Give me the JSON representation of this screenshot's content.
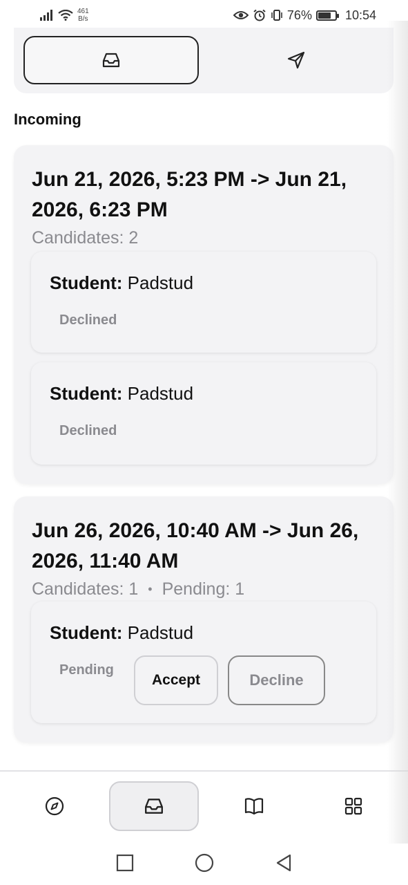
{
  "status_bar": {
    "net_speed_value": "461",
    "net_speed_unit": "B/s",
    "battery_percent": "76%",
    "battery_level": 0.76,
    "time": "10:54"
  },
  "tabs": [
    {
      "icon": "inbox-icon",
      "active": true
    },
    {
      "icon": "send-icon",
      "active": false
    }
  ],
  "section_title": "Incoming",
  "requests": [
    {
      "time_range": "Jun 21, 2026, 5:23 PM -> Jun 21, 2026, 6:23 PM",
      "candidates_text": "Candidates: 2",
      "pending_text": "",
      "candidates": [
        {
          "label": "Student:",
          "name": "Padstud",
          "status": "Declined"
        },
        {
          "label": "Student:",
          "name": "Padstud",
          "status": "Declined"
        }
      ]
    },
    {
      "time_range": "Jun 26, 2026, 10:40 AM -> Jun 26, 2026, 11:40 AM",
      "candidates_text": "Candidates: 1",
      "separator": "•",
      "pending_text": "Pending: 1",
      "candidates": [
        {
          "label": "Student:",
          "name": "Padstud",
          "status": "Pending",
          "accept_label": "Accept",
          "decline_label": "Decline"
        }
      ]
    }
  ],
  "bottom_nav": [
    {
      "icon": "compass-icon",
      "active": false
    },
    {
      "icon": "inbox-icon",
      "active": true
    },
    {
      "icon": "book-icon",
      "active": false
    },
    {
      "icon": "grid-icon",
      "active": false
    }
  ],
  "system_nav": [
    "square-icon",
    "circle-icon",
    "back-triangle-icon"
  ]
}
